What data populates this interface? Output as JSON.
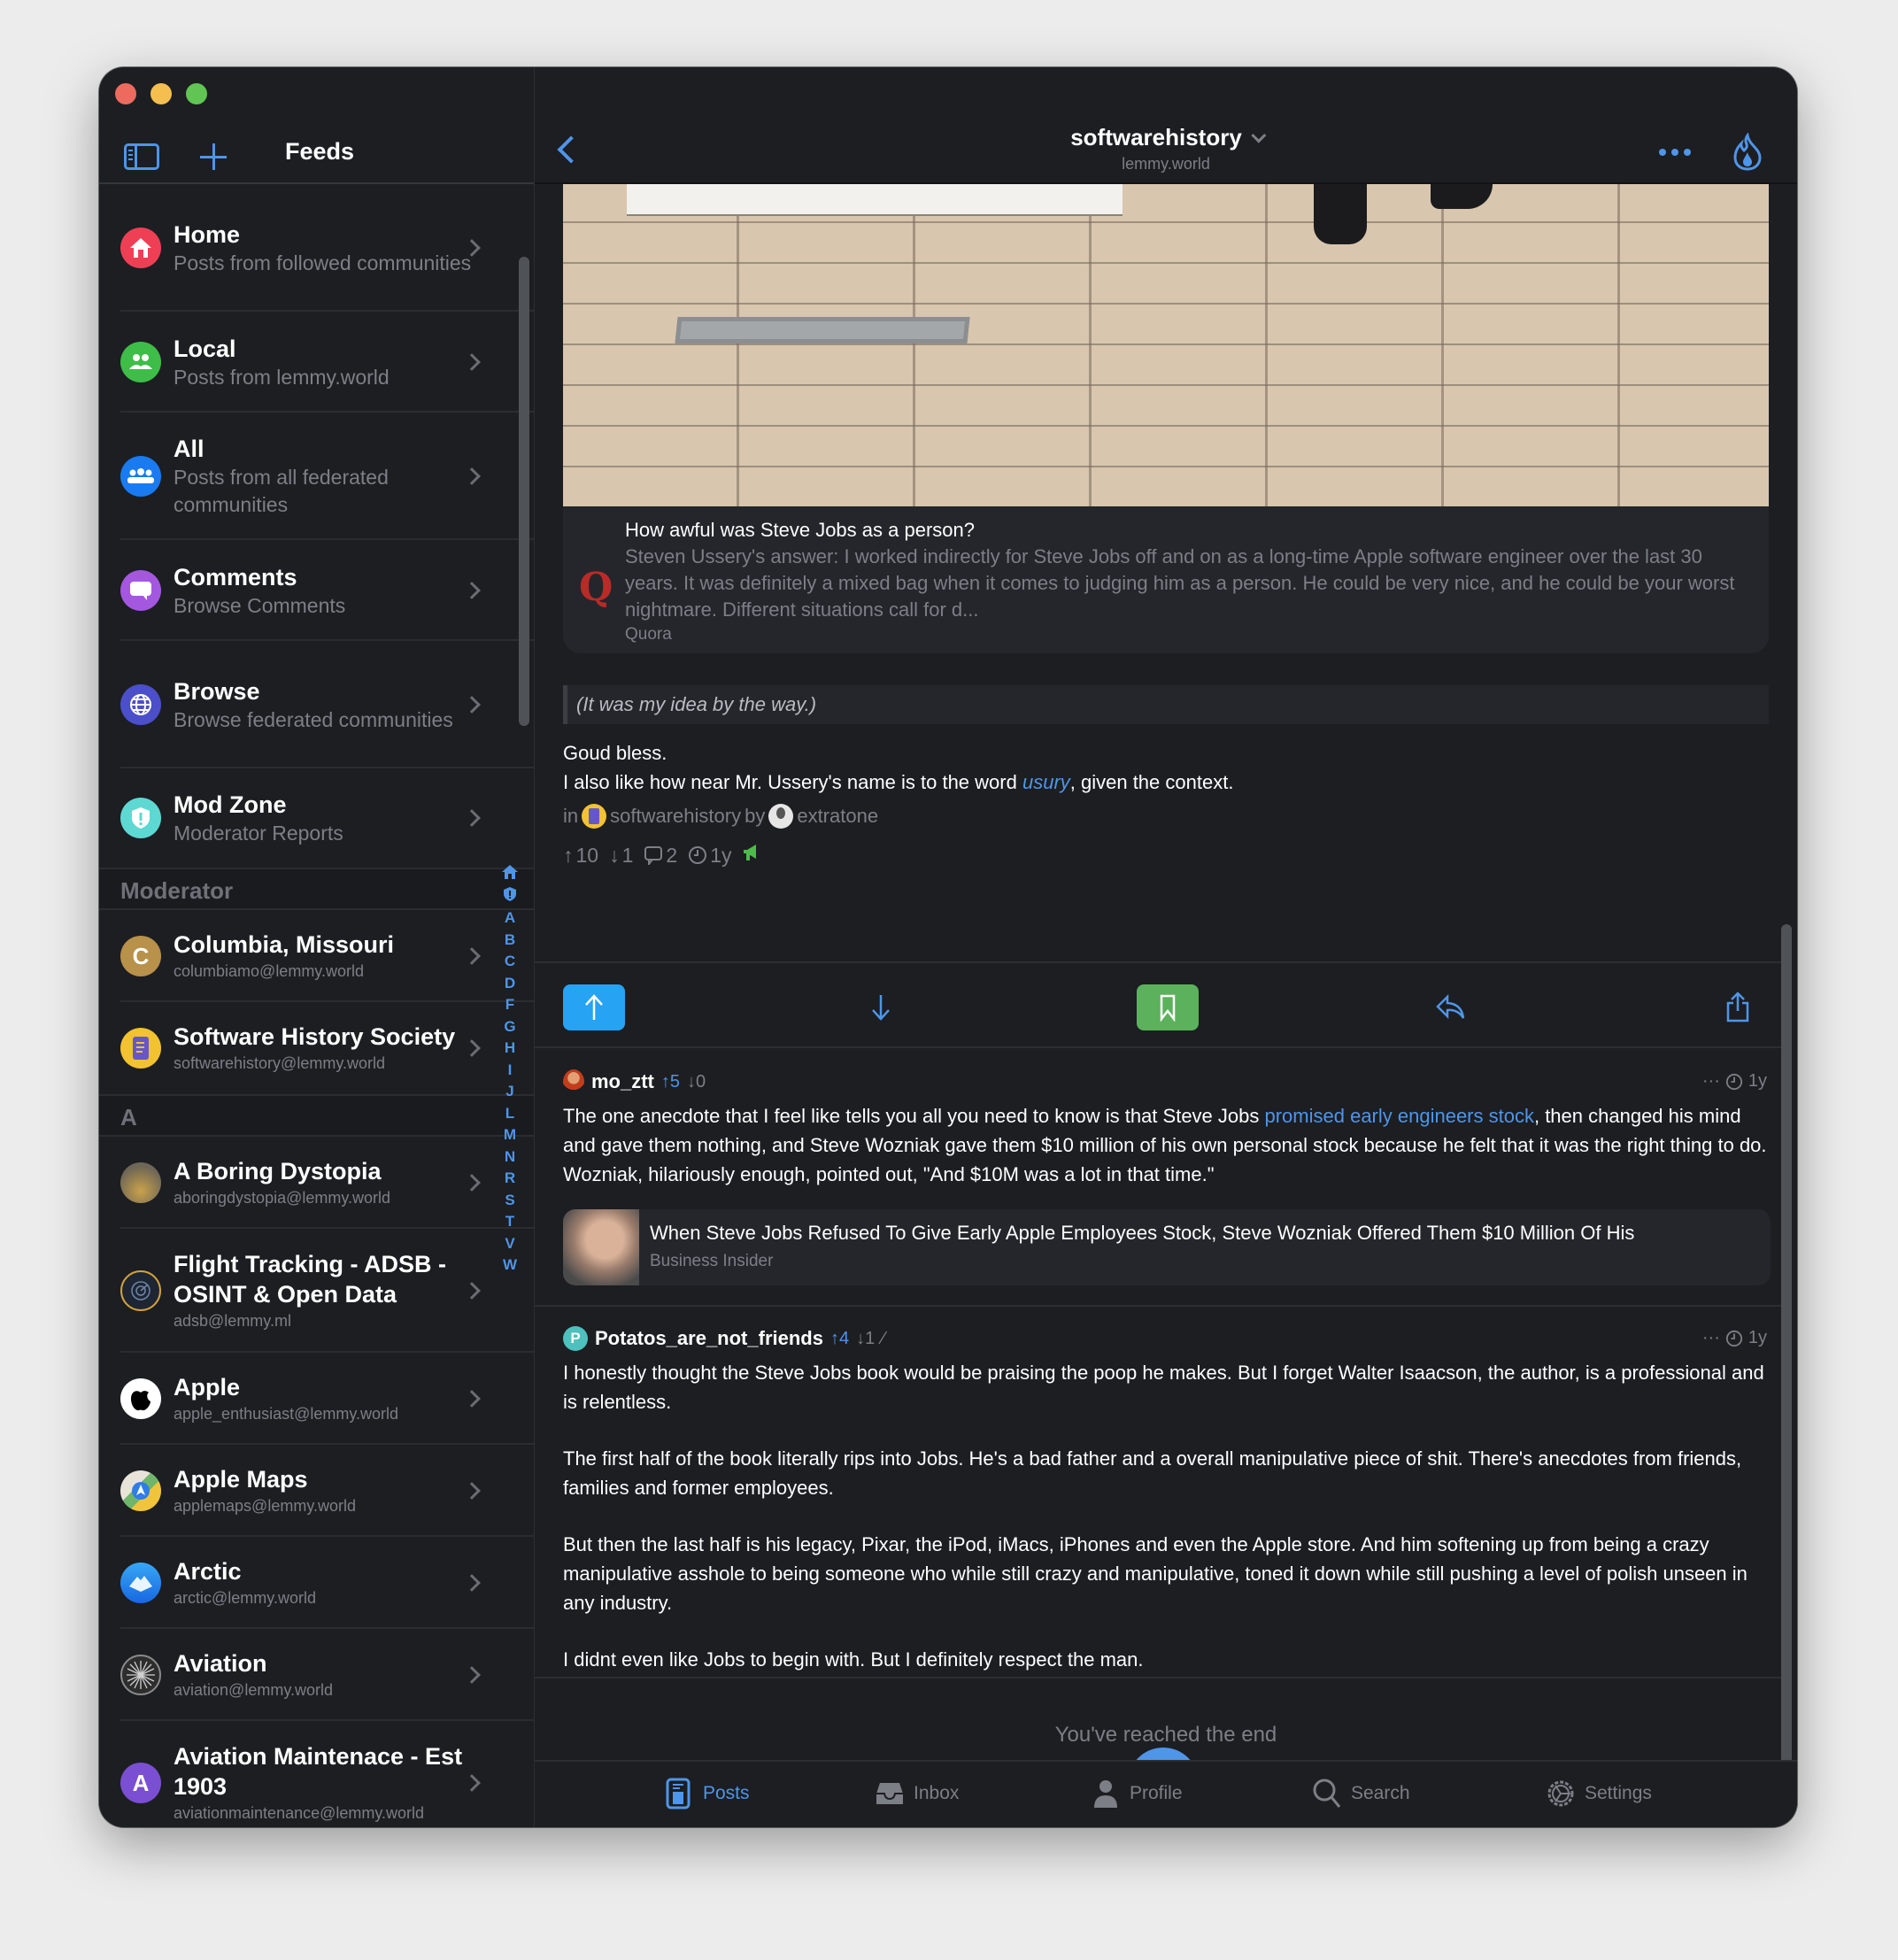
{
  "window": {
    "traffic_lights": [
      "close",
      "minimize",
      "zoom"
    ]
  },
  "sidebar": {
    "title": "Feeds",
    "toggle_icon": "sidebar-icon",
    "add_icon": "plus-icon",
    "feeds": [
      {
        "name": "Home",
        "sub": "Posts from followed communities",
        "icon": "house-icon",
        "color": "#ef3f55"
      },
      {
        "name": "Local",
        "sub": "Posts from lemmy.world",
        "icon": "people-icon",
        "color": "#3ebd48"
      },
      {
        "name": "All",
        "sub": "Posts from all federated communities",
        "icon": "group-icon",
        "color": "#1a7af0"
      },
      {
        "name": "Comments",
        "sub": "Browse Comments",
        "icon": "speech-bubble-icon",
        "color": "#a457df"
      },
      {
        "name": "Browse",
        "sub": "Browse federated communities",
        "icon": "globe-icon",
        "color": "#4b4fc9"
      },
      {
        "name": "Mod Zone",
        "sub": "Moderator Reports",
        "icon": "shield-icon",
        "color": "#5ed8d2"
      }
    ],
    "moderator_header": "Moderator",
    "moderated": [
      {
        "name": "Columbia, Missouri",
        "handle": "columbiamo@lemmy.world",
        "avatar_letter": "C",
        "color": "#b8914a"
      },
      {
        "name": "Software History Society",
        "handle": "softwarehistory@lemmy.world",
        "avatar_letter": "",
        "color": "#f2c230"
      }
    ],
    "section_a": "A",
    "communities": [
      {
        "name": "A Boring Dystopia",
        "handle": "aboringdystopia@lemmy.world",
        "avatar_letter": "",
        "color": "#8a7a55"
      },
      {
        "name": "Flight Tracking - ADSB - OSINT & Open Data",
        "handle": "adsb@lemmy.ml",
        "avatar_letter": "",
        "color": "#1e2633"
      },
      {
        "name": "Apple",
        "handle": "apple_enthusiast@lemmy.world",
        "avatar_letter": "",
        "color": "#ffffff"
      },
      {
        "name": "Apple Maps",
        "handle": "applemaps@lemmy.world",
        "avatar_letter": "",
        "color": "#5aa6e8"
      },
      {
        "name": "Arctic",
        "handle": "arctic@lemmy.world",
        "avatar_letter": "",
        "color": "#2f8ef2"
      },
      {
        "name": "Aviation",
        "handle": "aviation@lemmy.world",
        "avatar_letter": "",
        "color": "#3a3a3a"
      },
      {
        "name": "Aviation Maintenace - Est 1903",
        "handle": "aviationmaintenance@lemmy.world",
        "avatar_letter": "A",
        "color": "#7a4fd1"
      }
    ],
    "index_letters": [
      "A",
      "B",
      "C",
      "D",
      "F",
      "G",
      "H",
      "I",
      "J",
      "L",
      "M",
      "N",
      "R",
      "S",
      "T",
      "V",
      "W"
    ]
  },
  "header": {
    "title": "softwarehistory",
    "subtitle": "lemmy.world"
  },
  "post": {
    "link_card": {
      "title": "How awful was Steve Jobs as a person?",
      "description": "Steven Ussery's answer: I worked indirectly for Steve Jobs off and on as a long-time Apple software engineer over the last 30 years. It was definitely a mixed bag when it comes to judging him as a person. He could be very nice, and he could be your worst nightmare. Different situations call for d...",
      "source": "Quora"
    },
    "quote": "(It was my idea by the way.)",
    "body_line1": "Goud bless.",
    "body_line2_pre": "I also like how near Mr. Ussery's name is to the word ",
    "body_line2_link": "usury",
    "body_line2_post": ", given the context.",
    "in_label": "in",
    "community": "softwarehistory",
    "by_label": "by",
    "author": "extratone",
    "upvotes": "10",
    "downvotes": "1",
    "comments": "2",
    "age": "1y"
  },
  "actions": [
    "upvote",
    "downvote",
    "save",
    "reply",
    "share"
  ],
  "comments": [
    {
      "user": "mo_ztt",
      "up": "5",
      "down": "0",
      "age": "1y",
      "text_pre": "The one anecdote that I feel like tells you all you need to know is that Steve Jobs ",
      "text_link": "promised early engineers stock",
      "text_post": ", then changed his mind and gave them nothing, and Steve Wozniak gave them $10 million of his own personal stock because he felt that it was the right thing to do. Wozniak, hilariously enough, pointed out, \"And $10M was a lot in that time.\"",
      "embed_title": "When Steve Jobs Refused To Give Early Apple Employees Stock, Steve Wozniak Offered Them $10 Million Of His",
      "embed_source": "Business Insider"
    },
    {
      "user": "Potatos_are_not_friends",
      "avatar_letter": "P",
      "up": "4",
      "down": "1",
      "age": "1y",
      "paragraphs": [
        "I honestly thought the Steve Jobs book would be praising the poop he makes. But I forget Walter Isaacson, the author, is a professional and is relentless.",
        "The first half of the book literally rips into Jobs. He's a bad father and a overall manipulative piece of shit. There's anecdotes from friends, families and former employees.",
        "But then the last half is his legacy, Pixar,  the iPod, iMacs, iPhones and even the Apple store. And him softening up from being a crazy manipulative asshole to being someone who while still crazy and manipulative, toned it down while still pushing a level of polish unseen in any industry.",
        "I didnt even like Jobs to begin with. But I definitely respect the man."
      ]
    }
  ],
  "end_text": "You've reached the end",
  "tabs": [
    {
      "label": "Posts",
      "active": true
    },
    {
      "label": "Inbox",
      "active": false
    },
    {
      "label": "Profile",
      "active": false
    },
    {
      "label": "Search",
      "active": false
    },
    {
      "label": "Settings",
      "active": false
    }
  ],
  "colors": {
    "accent": "#4f95e8",
    "upvote": "#26a3f2",
    "save": "#5cb15c",
    "background": "#1c1e22"
  }
}
